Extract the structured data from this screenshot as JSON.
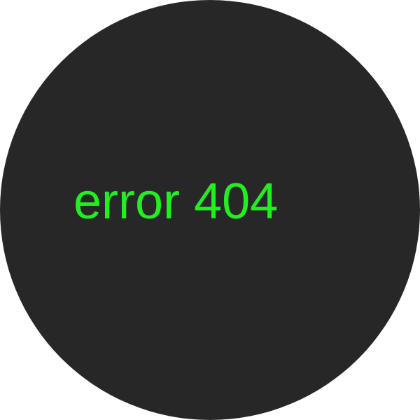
{
  "screen": {
    "message": "error 404"
  },
  "colors": {
    "background": "#272727",
    "text": "#22ee22"
  }
}
